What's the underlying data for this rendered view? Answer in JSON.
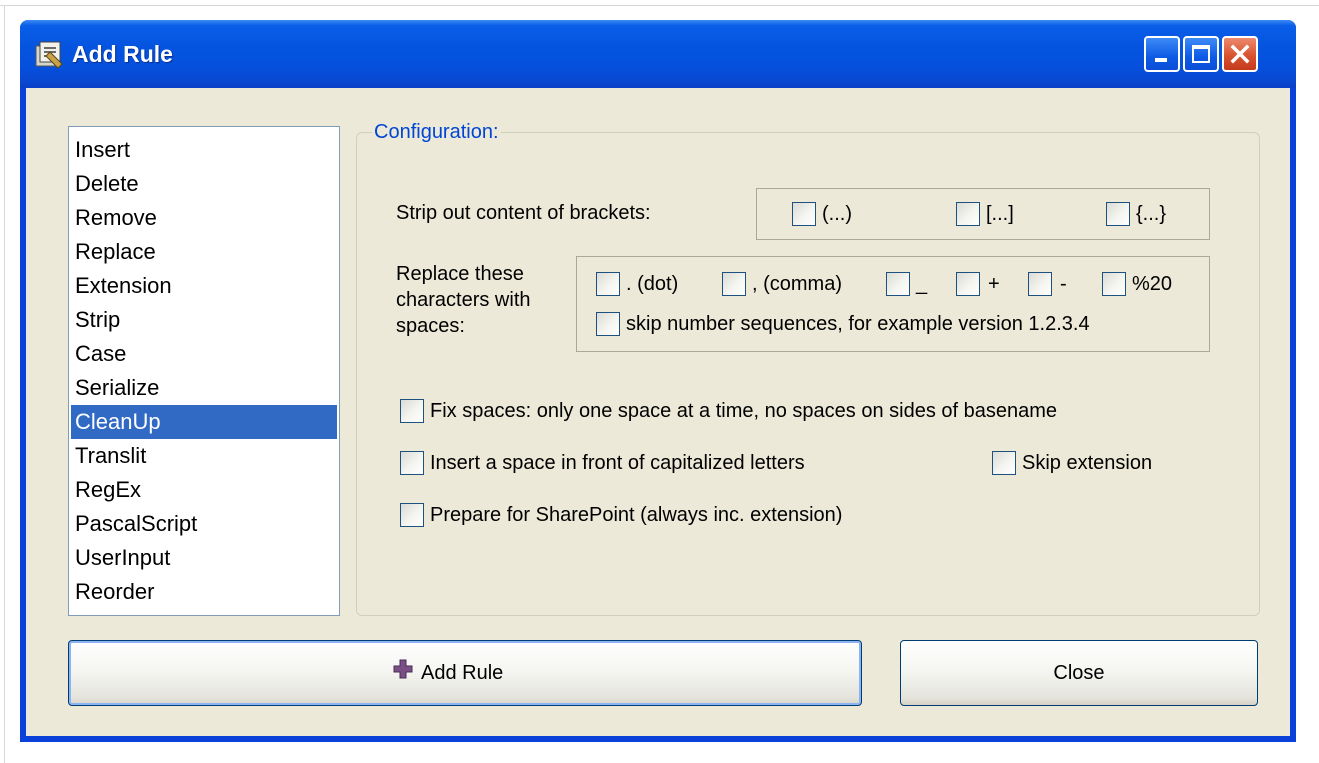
{
  "window": {
    "title": "Add Rule",
    "controls": [
      "minimize-icon",
      "maximize-icon",
      "close-icon"
    ]
  },
  "rule_list": {
    "items": [
      "Insert",
      "Delete",
      "Remove",
      "Replace",
      "Extension",
      "Strip",
      "Case",
      "Serialize",
      "CleanUp",
      "Translit",
      "RegEx",
      "PascalScript",
      "UserInput",
      "Reorder"
    ],
    "selected": "CleanUp"
  },
  "config": {
    "caption": "Configuration:",
    "brackets": {
      "label": "Strip out content of brackets:",
      "options": [
        {
          "label": "(...)",
          "checked": false
        },
        {
          "label": "[...]",
          "checked": false
        },
        {
          "label": "{...}",
          "checked": false
        }
      ]
    },
    "replace": {
      "label_line1": "Replace these",
      "label_line2": "characters with",
      "label_line3": "spaces:",
      "options": [
        {
          "label": ". (dot)",
          "checked": false
        },
        {
          "label": ", (comma)",
          "checked": false
        },
        {
          "label": "_",
          "checked": false
        },
        {
          "label": "+",
          "checked": false
        },
        {
          "label": "-",
          "checked": false
        },
        {
          "label": "%20",
          "checked": false
        }
      ],
      "skip_numbers": {
        "label": "skip number sequences, for example version 1.2.3.4",
        "checked": false
      }
    },
    "fix_spaces": {
      "label": "Fix spaces: only one space at a time, no spaces on sides of basename",
      "checked": false
    },
    "insert_space": {
      "label": "Insert a space in front of capitalized letters",
      "checked": false
    },
    "skip_extension": {
      "label": "Skip extension",
      "checked": false
    },
    "sharepoint": {
      "label": "Prepare for SharePoint (always inc. extension)",
      "checked": false
    }
  },
  "buttons": {
    "add_rule": "Add Rule",
    "close": "Close"
  },
  "icons": {
    "app": "app-icon",
    "add": "plus-icon"
  }
}
